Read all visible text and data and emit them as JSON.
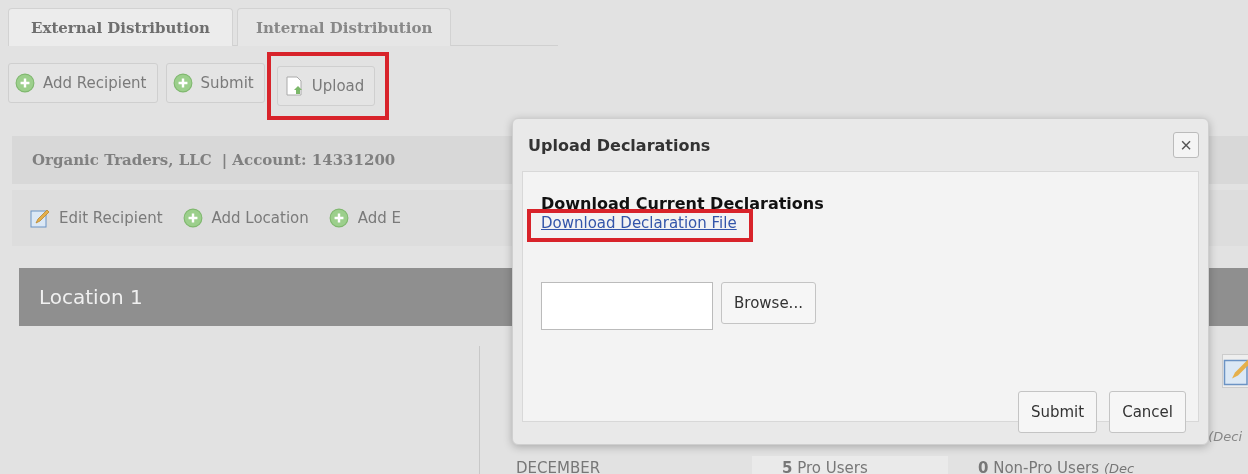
{
  "tabs": [
    {
      "label": "External Distribution",
      "selected": true
    },
    {
      "label": "Internal Distribution",
      "selected": false
    }
  ],
  "toolbar": [
    {
      "label": "Add Recipient",
      "highlighted": false
    },
    {
      "label": "Submit",
      "highlighted": false
    },
    {
      "label": "Upload",
      "highlighted": true
    }
  ],
  "account_header": {
    "company": "Organic Traders, LLC",
    "account": "| Account: 14331200"
  },
  "recipient_toolbar": [
    {
      "label": "Edit Recipient"
    },
    {
      "label": "Add Location"
    },
    {
      "label": "Add E"
    }
  ],
  "location": {
    "title": "Location 1"
  },
  "side_note": "(Deci",
  "summary_row": {
    "month": "DECEMBER",
    "pro_count": "5",
    "pro_label": "Pro Users",
    "nonpro_count": "0",
    "nonpro_label": "Non-Pro Users",
    "nonpro_note": "(Dec"
  },
  "dialog": {
    "title": "Upload Declarations",
    "close": "×",
    "section_title": "Download Current Declarations",
    "link": "Download Declaration File",
    "link_highlighted": true,
    "browse": "Browse...",
    "buttons": [
      "Submit",
      "Cancel"
    ]
  }
}
